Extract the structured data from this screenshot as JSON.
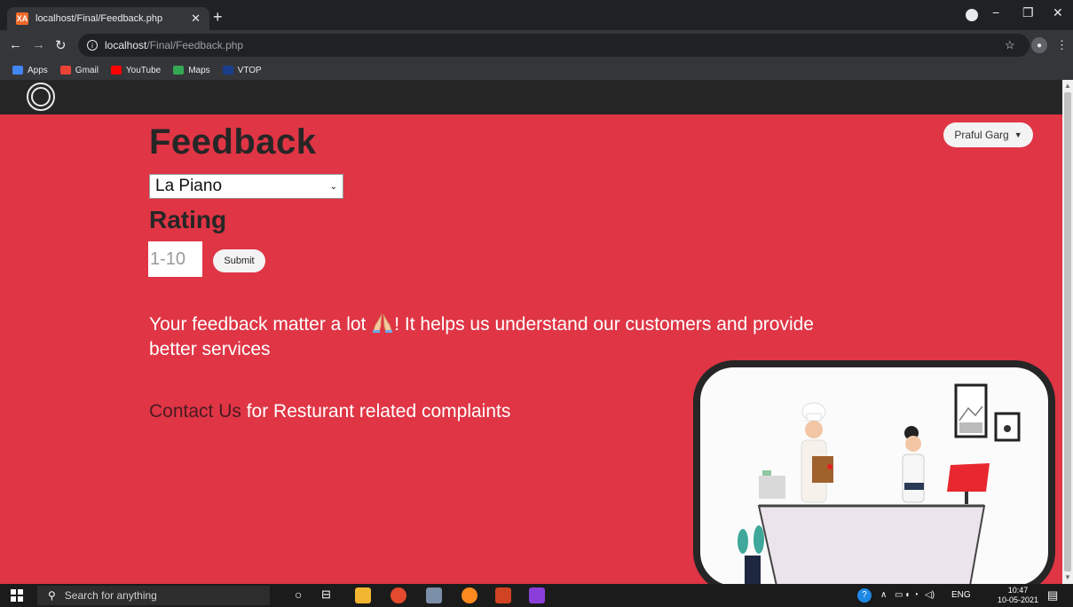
{
  "browser": {
    "tab_title": "localhost/Final/Feedback.php",
    "favicon_text": "XA",
    "url_host": "localhost",
    "url_path": "/Final/Feedback.php",
    "bookmarks": [
      {
        "label": "Apps",
        "color": "#4285f4"
      },
      {
        "label": "Gmail",
        "color": "#ea4335"
      },
      {
        "label": "YouTube",
        "color": "#ff0000"
      },
      {
        "label": "Maps",
        "color": "#34a853"
      },
      {
        "label": "VTOP",
        "color": "#1a3e8c"
      }
    ]
  },
  "page": {
    "title": "Feedback",
    "restaurant_select": {
      "value": "La Piano"
    },
    "rating_heading": "Rating",
    "rating_input": {
      "placeholder": "1-10"
    },
    "submit_label": "Submit",
    "user_menu": "Praful Garg",
    "message_before": "Your feedback matter a lot ",
    "message_after": "! It helps us understand our customers and provide better services",
    "contact_link": "Contact Us",
    "contact_text": " for Resturant related complaints",
    "colors": {
      "page_bg": "#df3545",
      "navbar": "#262626"
    }
  },
  "taskbar": {
    "search_placeholder": "Search for anything",
    "language": "ENG",
    "time": "10:47",
    "date": "10-05-2021"
  }
}
